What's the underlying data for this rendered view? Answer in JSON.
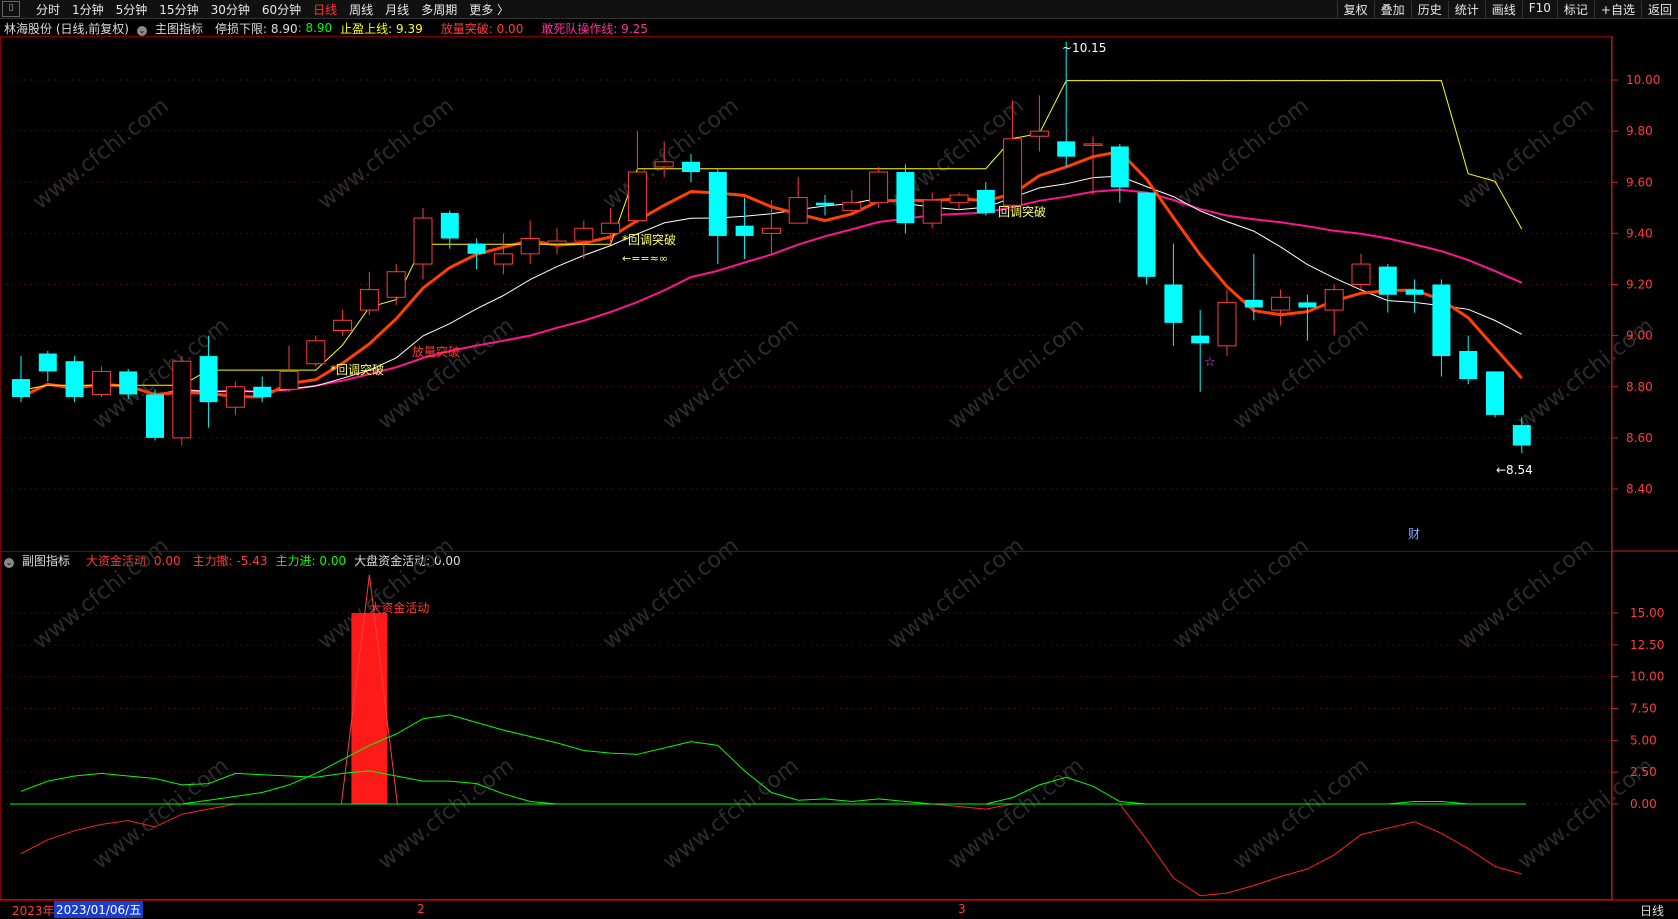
{
  "toolbar": {
    "periods": [
      "分时",
      "1分钟",
      "5分钟",
      "15分钟",
      "30分钟",
      "60分钟",
      "日线",
      "周线",
      "月线",
      "多周期",
      "更多 〉"
    ],
    "active_index": 6,
    "right_items": [
      "复权",
      "叠加",
      "历史",
      "统计",
      "画线",
      "F10",
      "标记",
      "+自选",
      "返回"
    ]
  },
  "main_header": {
    "stock": "林海股份 (日线,前复权)",
    "indicator": "主图指标",
    "stop_loss": "停损下限: 8.90",
    "stop_loss_val": ": 8.90",
    "take_profit": "止盈上线: 9.39",
    "volume_break": "放量突破: 0.00",
    "dare_line": "敢死队操作线: 9.25"
  },
  "sub_header": {
    "indicator": "副图指标",
    "big_fund": "大资金活动: 0.00",
    "main_out": "主力撤: -5.43",
    "main_in": "主力进: 0.00",
    "market_fund": "大盘资金活动: 0.00"
  },
  "annotations": {
    "high_label": "10.15",
    "low_label": "8.54",
    "pullback1": "*回调突破",
    "pullback2": "*回调突破",
    "pullback3": "回调突破",
    "volume_break": "放量突破",
    "arrow_text": "←==≈∞",
    "fin_mark": "财",
    "star": "☆",
    "sub_bar_label": "大资金活动"
  },
  "bottom": {
    "year": "2023年",
    "date": "2023/01/06/五",
    "m2": "2",
    "m3": "3",
    "period": "日线"
  },
  "watermark": "www.cfchi.com",
  "colors": {
    "up": "#ff3b3b",
    "down": "#00ffff",
    "ma_red": "#ff4000",
    "ma_white": "#ffffff",
    "ma_magenta": "#ff1493",
    "ma_yellow": "#ffff00",
    "green": "#00ff00",
    "axis": "#ff3b3b"
  },
  "chart_data": [
    {
      "type": "candlestick",
      "ylim": [
        8.2,
        10.2
      ],
      "yticks": [
        8.4,
        8.6,
        8.8,
        9.0,
        9.2,
        9.4,
        9.6,
        9.8,
        10.0
      ],
      "candles": [
        [
          8.83,
          8.76,
          8.92,
          8.74
        ],
        [
          8.93,
          8.86,
          8.94,
          8.82
        ],
        [
          8.9,
          8.76,
          8.92,
          8.74
        ],
        [
          8.77,
          8.86,
          8.88,
          8.76
        ],
        [
          8.86,
          8.77,
          8.87,
          8.75
        ],
        [
          8.77,
          8.6,
          8.79,
          8.59
        ],
        [
          8.6,
          8.9,
          8.92,
          8.57
        ],
        [
          8.92,
          8.74,
          9.0,
          8.64
        ],
        [
          8.72,
          8.8,
          8.82,
          8.69
        ],
        [
          8.8,
          8.76,
          8.84,
          8.74
        ],
        [
          8.79,
          8.86,
          8.96,
          8.78
        ],
        [
          8.89,
          8.98,
          9.0,
          8.88
        ],
        [
          9.02,
          9.06,
          9.1,
          9.0
        ],
        [
          9.1,
          9.18,
          9.25,
          9.08
        ],
        [
          9.15,
          9.25,
          9.28,
          9.12
        ],
        [
          9.28,
          9.46,
          9.5,
          9.22
        ],
        [
          9.48,
          9.38,
          9.49,
          9.34
        ],
        [
          9.36,
          9.32,
          9.38,
          9.26
        ],
        [
          9.28,
          9.32,
          9.4,
          9.24
        ],
        [
          9.32,
          9.38,
          9.45,
          9.28
        ],
        [
          9.36,
          9.37,
          9.42,
          9.32
        ],
        [
          9.37,
          9.42,
          9.45,
          9.3
        ],
        [
          9.4,
          9.44,
          9.5,
          9.36
        ],
        [
          9.45,
          9.64,
          9.8,
          9.44
        ],
        [
          9.66,
          9.68,
          9.76,
          9.62
        ],
        [
          9.68,
          9.64,
          9.71,
          9.6
        ],
        [
          9.64,
          9.39,
          9.65,
          9.28
        ],
        [
          9.43,
          9.39,
          9.54,
          9.3
        ],
        [
          9.4,
          9.42,
          9.53,
          9.32
        ],
        [
          9.44,
          9.54,
          9.62,
          9.44
        ],
        [
          9.52,
          9.51,
          9.55,
          9.47
        ],
        [
          9.49,
          9.52,
          9.57,
          9.47
        ],
        [
          9.52,
          9.64,
          9.66,
          9.5
        ],
        [
          9.64,
          9.44,
          9.67,
          9.4
        ],
        [
          9.44,
          9.53,
          9.56,
          9.42
        ],
        [
          9.52,
          9.55,
          9.56,
          9.49
        ],
        [
          9.57,
          9.48,
          9.6,
          9.47
        ],
        [
          9.51,
          9.77,
          9.92,
          9.49
        ],
        [
          9.78,
          9.8,
          9.94,
          9.72
        ],
        [
          9.76,
          9.7,
          10.15,
          9.66
        ],
        [
          9.75,
          9.75,
          9.78,
          9.55
        ],
        [
          9.74,
          9.58,
          9.75,
          9.52
        ],
        [
          9.56,
          9.23,
          9.56,
          9.2
        ],
        [
          9.2,
          9.05,
          9.36,
          8.96
        ],
        [
          9.0,
          8.97,
          9.1,
          8.78
        ],
        [
          8.96,
          9.13,
          9.18,
          8.92
        ],
        [
          9.14,
          9.11,
          9.32,
          9.06
        ],
        [
          9.1,
          9.15,
          9.18,
          9.04
        ],
        [
          9.13,
          9.11,
          9.16,
          8.98
        ],
        [
          9.1,
          9.18,
          9.2,
          9.0
        ],
        [
          9.2,
          9.28,
          9.32,
          9.18
        ],
        [
          9.27,
          9.16,
          9.28,
          9.09
        ],
        [
          9.18,
          9.16,
          9.22,
          9.09
        ],
        [
          9.2,
          8.92,
          9.22,
          8.84
        ],
        [
          8.94,
          8.83,
          9.0,
          8.81
        ],
        [
          8.86,
          8.69,
          8.86,
          8.68
        ],
        [
          8.65,
          8.57,
          8.68,
          8.54
        ]
      ]
    },
    {
      "type": "line",
      "ylim": [
        -3.75,
        18.75
      ],
      "yticks": [
        0.0,
        2.5,
        5.0,
        7.5,
        10.0,
        12.5,
        15.0
      ],
      "series": [
        {
          "values": [
            1.0,
            1.8,
            2.2,
            2.4,
            2.2,
            2.0,
            1.5,
            1.6,
            2.4,
            2.3,
            2.2,
            2.1,
            2.4,
            2.6,
            2.2,
            1.8,
            1.8,
            1.6,
            0.8,
            0.2,
            0.0,
            0.0,
            0.0,
            0.0,
            0.0,
            0.0,
            0.0,
            0.0,
            0.0,
            0.0,
            0.0,
            0.0,
            0.0,
            0.0,
            0.0,
            0.0,
            0.0,
            0.0,
            0.0,
            0.0,
            0.0,
            0.0,
            0.0,
            0.0,
            0.0,
            0.0,
            0.0,
            0.0,
            0.0,
            0.0,
            0.0,
            0.0,
            0.0,
            0.0,
            0.0,
            0.0,
            0.0
          ]
        },
        {
          "values": [
            0.0,
            0.0,
            0.0,
            0.0,
            0.0,
            0.0,
            0.0,
            0.3,
            0.6,
            0.9,
            1.5,
            2.4,
            3.5,
            4.6,
            5.5,
            6.7,
            7.0,
            6.4,
            5.8,
            5.3,
            4.8,
            4.2,
            4.0,
            3.9,
            4.4,
            4.9,
            4.6,
            2.6,
            0.9,
            0.3,
            0.4,
            0.2,
            0.4,
            0.2,
            0.0,
            0.0,
            0.0,
            0.5,
            1.5,
            2.1,
            1.4,
            0.2,
            0.0,
            0.0,
            0.0,
            0.0,
            0.0,
            0.0,
            0.0,
            0.0,
            0.0,
            0.0,
            0.2,
            0.2,
            0.0,
            0.0,
            0.0
          ]
        },
        {
          "values": [
            -3.9,
            -2.8,
            -2.1,
            -1.6,
            -1.3,
            -1.8,
            -0.8,
            -0.4,
            0.0,
            0.0,
            0.0,
            0.0,
            0.0,
            0.0,
            0.0,
            0.0,
            0.0,
            0.0,
            0.0,
            0.0,
            0.0,
            0.0,
            0.0,
            0.0,
            0.0,
            0.0,
            0.0,
            0.0,
            0.0,
            0.0,
            0.0,
            0.0,
            0.0,
            0.0,
            0.0,
            -0.2,
            -0.4,
            0.0,
            0.0,
            0.0,
            0.0,
            0.0,
            -2.8,
            -5.8,
            -7.2,
            -7.0,
            -6.4,
            -5.7,
            -5.1,
            -4.0,
            -2.4,
            -1.9,
            -1.4,
            -2.3,
            -3.5,
            -4.9,
            -5.5
          ]
        }
      ],
      "bars": [
        {
          "index": 13,
          "value": 15.0
        }
      ]
    }
  ]
}
